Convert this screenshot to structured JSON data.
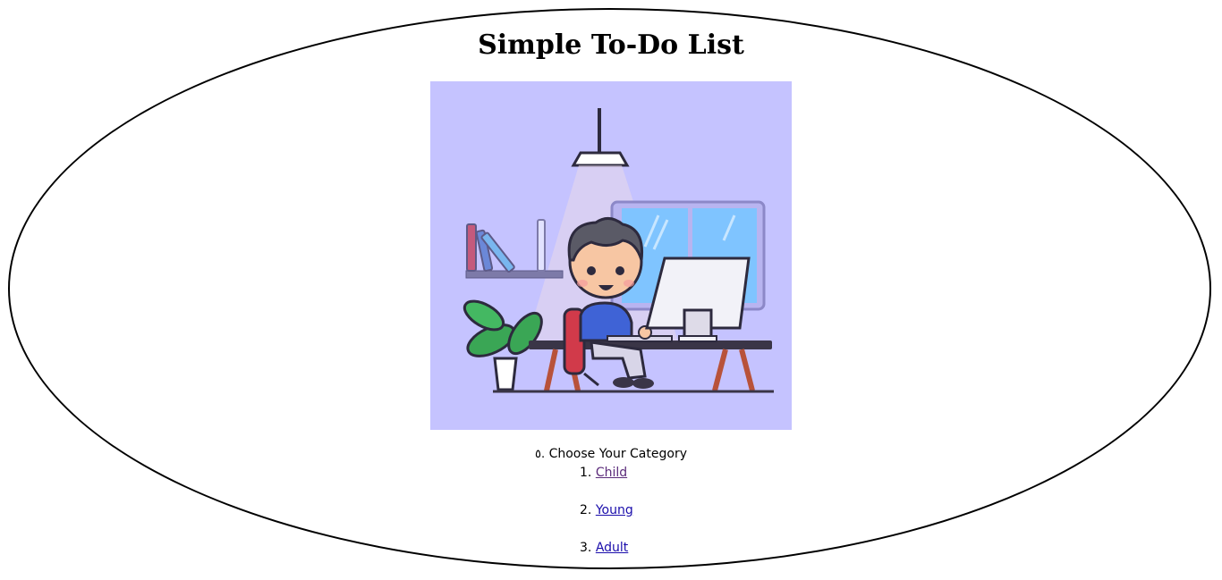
{
  "page": {
    "title": "Simple To-Do List"
  },
  "hero": {
    "icon": "person-at-computer-illustration",
    "background": "#c5c3ff"
  },
  "categories": {
    "marker": "٥.",
    "heading": "Choose Your Category",
    "items": [
      {
        "number": "1.",
        "label": "Child",
        "visited": true
      },
      {
        "number": "2.",
        "label": "Young",
        "visited": false
      },
      {
        "number": "3.",
        "label": "Adult",
        "visited": false
      }
    ]
  },
  "colors": {
    "link": "#1a0dab",
    "visited_link": "#5b2b7a"
  }
}
